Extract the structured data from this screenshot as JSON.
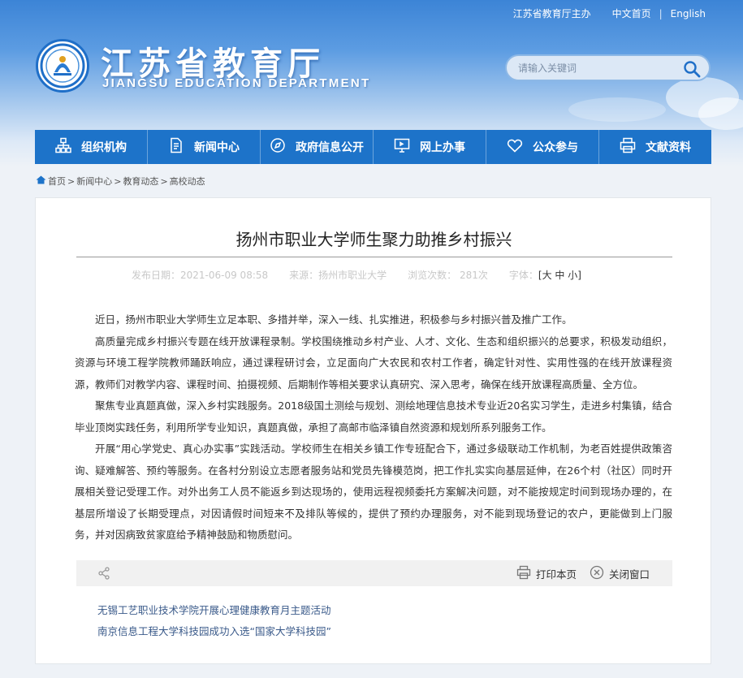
{
  "header": {
    "top_links": [
      "江苏省教育厅主办",
      "中文首页",
      "English"
    ],
    "title_cn": "江苏省教育厅",
    "title_en": "JIANGSU EDUCATION DEPARTMENT",
    "search_placeholder": "请输入关键词"
  },
  "nav": {
    "items": [
      {
        "label": "组织机构",
        "icon": "org-chart-icon"
      },
      {
        "label": "新闻中心",
        "icon": "document-icon"
      },
      {
        "label": "政府信息公开",
        "icon": "compass-icon"
      },
      {
        "label": "网上办事",
        "icon": "monitor-icon"
      },
      {
        "label": "公众参与",
        "icon": "heart-icon"
      },
      {
        "label": "文献资料",
        "icon": "printer-icon"
      }
    ]
  },
  "breadcrumb": [
    "首页",
    "新闻中心",
    "教育动态",
    "高校动态"
  ],
  "article": {
    "title": "扬州市职业大学师生聚力助推乡村振兴",
    "publish_date": "发布日期：2021-06-09 08:58",
    "source": "来源：扬州市职业大学",
    "views": "浏览次数：  281次",
    "font_size_label": "字体：",
    "font_size_options": "[大 中 小]",
    "paragraphs": [
      "近日，扬州市职业大学师生立足本职、多措并举，深入一线、扎实推进，积极参与乡村振兴普及推广工作。",
      "高质量完成乡村振兴专题在线开放课程录制。学校围绕推动乡村产业、人才、文化、生态和组织振兴的总要求，积极发动组织，资源与环境工程学院教师踊跃响应，通过课程研讨会，立足面向广大农民和农村工作者，确定针对性、实用性强的在线开放课程资源，教师们对教学内容、课程时间、拍摄视频、后期制作等相关要求认真研究、深入思考，确保在线开放课程高质量、全方位。",
      "聚焦专业真题真做，深入乡村实践服务。2018级国土测绘与规划、测绘地理信息技术专业近20名实习学生，走进乡村集镇，结合毕业顶岗实践任务，利用所学专业知识，真题真做，承担了高邮市临泽镇自然资源和规划所系列服务工作。",
      "开展“用心学党史、真心办实事”实践活动。学校师生在相关乡镇工作专班配合下，通过多级联动工作机制，为老百姓提供政策咨询、疑难解答、预约等服务。在各村分别设立志愿者服务站和党员先锋模范岗，把工作扎实实向基层延伸，在26个村（社区）同时开展相关登记受理工作。对外出务工人员不能返乡到达现场的，使用远程视频委托方案解决问题，对不能按规定时间到现场办理的，在基层所增设了长期受理点，对因请假时间短来不及排队等候的，提供了预约办理服务，对不能到现场登记的农户，更能做到上门服务，并对因病致贫家庭给予精神鼓励和物质慰问。"
    ],
    "print_label": "打印本页",
    "close_label": "关闭窗口"
  },
  "related": [
    "无锡工艺职业技术学院开展心理健康教育月主题活动",
    "南京信息工程大学科技园成功入选“国家大学科技园”"
  ],
  "colors": {
    "nav_bg": "#1d73c9",
    "header_top": "#3c84d6",
    "link": "#3a5a8a"
  }
}
